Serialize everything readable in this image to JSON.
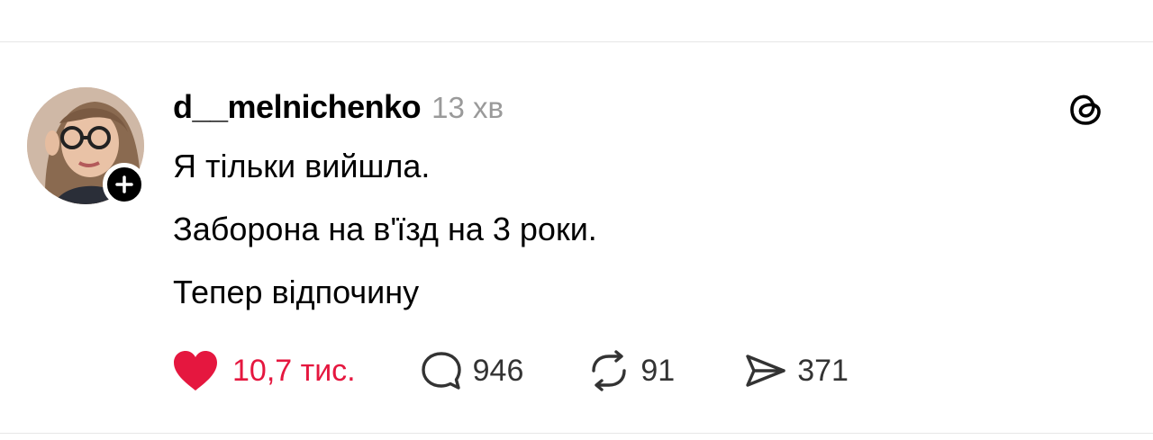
{
  "post": {
    "username": "d__melnichenko",
    "timestamp": "13 хв",
    "lines": [
      "Я тільки вийшла.",
      "Заборона на в'їзд на 3 роки.",
      "Тепер відпочину"
    ],
    "stats": {
      "likes": "10,7 тис.",
      "replies": "946",
      "reposts": "91",
      "shares": "371"
    },
    "liked": true
  },
  "colors": {
    "like_red": "#e5173f",
    "text": "#000000",
    "muted": "#9a9a9a"
  },
  "icons": {
    "like": "heart-filled-icon",
    "reply": "speech-bubble-icon",
    "repost": "repost-arrows-icon",
    "share": "paper-plane-icon",
    "app": "threads-logo-icon",
    "follow": "plus-icon"
  }
}
